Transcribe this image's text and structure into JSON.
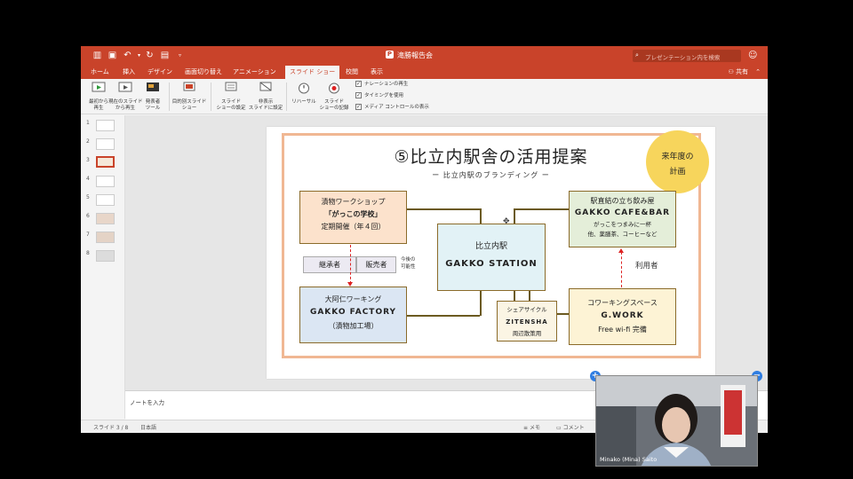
{
  "window": {
    "title": "滝勝報告会"
  },
  "search": {
    "placeholder": "プレゼンテーション内を検索"
  },
  "tabs": [
    {
      "label": "ホーム"
    },
    {
      "label": "挿入"
    },
    {
      "label": "デザイン"
    },
    {
      "label": "画面切り替え"
    },
    {
      "label": "アニメーション"
    },
    {
      "label": "スライド ショー",
      "active": true
    },
    {
      "label": "校閲"
    },
    {
      "label": "表示"
    }
  ],
  "share_label": "共有",
  "ribbon": {
    "buttons": [
      {
        "label": "最初から\n再生"
      },
      {
        "label": "現在のスライド\nから再生"
      },
      {
        "label": "発表者\nツール"
      },
      {
        "label": "目的別スライド\nショー"
      },
      {
        "label": "スライド\nショーの設定"
      },
      {
        "label": "非表示\nスライドに設定"
      },
      {
        "label": "リハーサル"
      },
      {
        "label": "スライド\nショーの記録"
      }
    ],
    "checkboxes": [
      {
        "label": "ナレーションの再生",
        "checked": true
      },
      {
        "label": "タイミングを使用",
        "checked": true
      },
      {
        "label": "メディア コントロールの表示",
        "checked": true
      }
    ]
  },
  "thumbnails": [
    "1",
    "2",
    "3",
    "4",
    "5",
    "6",
    "7",
    "8"
  ],
  "selected_slide_index": 2,
  "slide": {
    "title": "⑤比立内駅舎の活用提案",
    "subtitle": "ー 比立内駅のブランディング ー",
    "bubble": [
      "来年度の",
      "計画"
    ],
    "box_workshop": [
      "漬物ワークショップ",
      "「がっこの学校」",
      "定期開催（年４回）"
    ],
    "box_station": [
      "比立内駅",
      "GAKKO STATION"
    ],
    "box_cafe": [
      "駅直結の立ち飲み屋",
      "GAKKO CAFE&BAR",
      "がっこをつまみに一杯",
      "他、薬膳茶、コーヒーなど"
    ],
    "box_factory": [
      "大阿仁ワーキング",
      "GAKKO FACTORY",
      "（漬物加工場）"
    ],
    "box_cycle": [
      "シェアサイクル",
      "ZITENSHA",
      "周辺散策用"
    ],
    "box_work": [
      "コワーキングスペース",
      "G.WORK",
      "Free wi-fi 完備"
    ],
    "tag_successor": "継承者",
    "tag_seller": "販売者",
    "note_future": [
      "今後の",
      "可能性"
    ],
    "user_label": "利用者"
  },
  "notes_placeholder": "ノートを入力",
  "status": {
    "slide_counter": "スライド 3 / 8",
    "language": "日本語",
    "notes_btn": "メモ",
    "comments_btn": "コメント"
  },
  "video": {
    "participant": "Minako (Mina) Saito"
  },
  "colors": {
    "accent": "#c9432a",
    "frame": "#f0b793",
    "bubble": "#f7d55c"
  }
}
